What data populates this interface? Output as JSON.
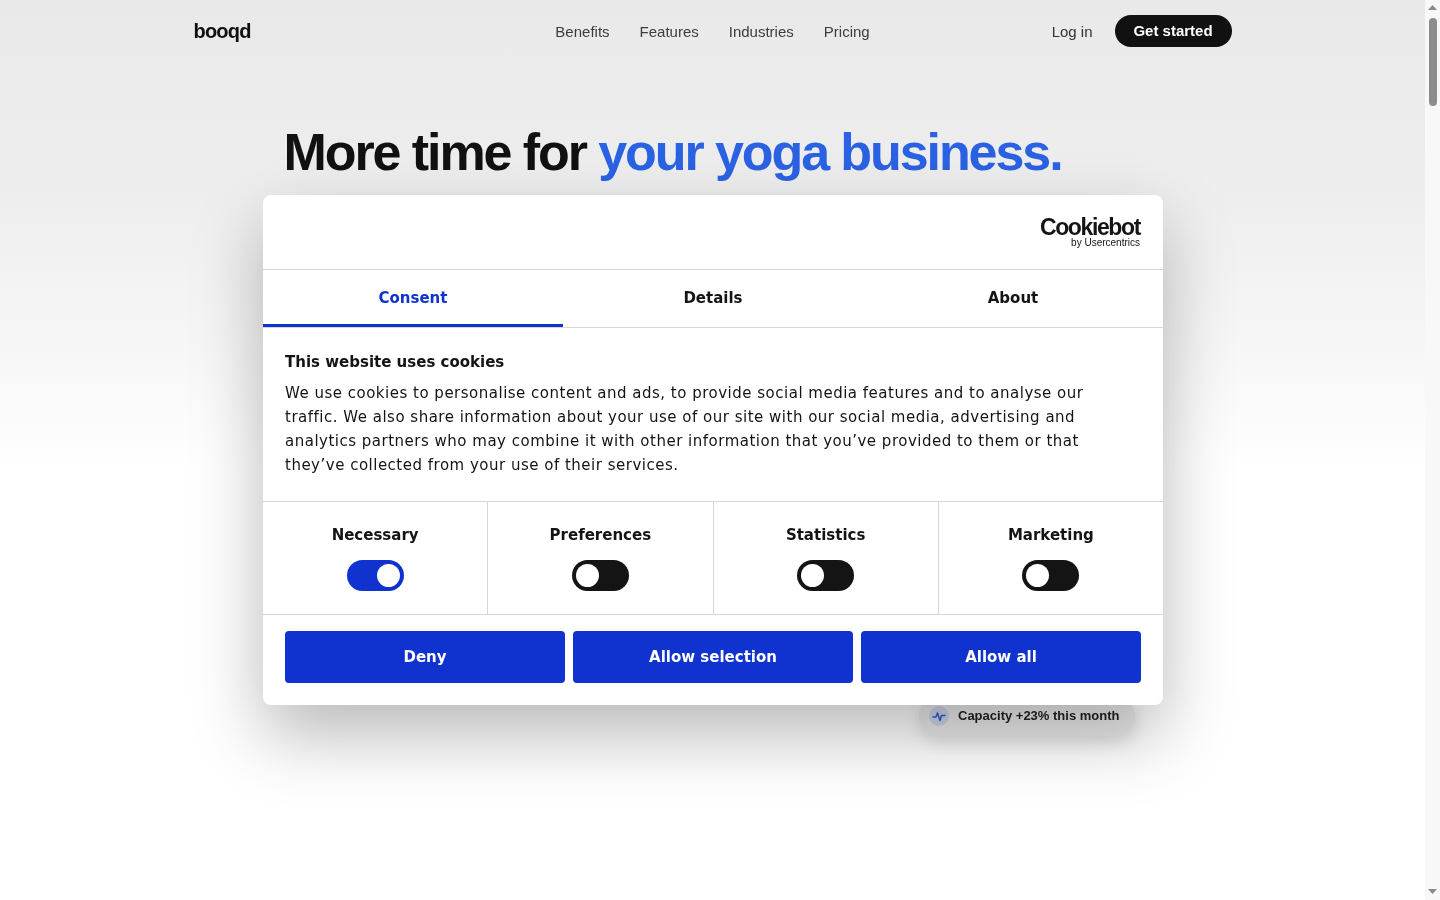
{
  "nav": {
    "logo": "booqd",
    "links": [
      {
        "label": "Benefits"
      },
      {
        "label": "Features"
      },
      {
        "label": "Industries"
      },
      {
        "label": "Pricing"
      }
    ],
    "login": "Log in",
    "cta": "Get started"
  },
  "hero": {
    "headline_lead": "More time for",
    "headline_highlight": "your yoga business.",
    "badge": "Capacity +23% this month"
  },
  "cookie_dialog": {
    "logo": {
      "wordmark": "Cookiebot",
      "byline": "by Usercentrics"
    },
    "tabs": [
      {
        "label": "Consent",
        "selected": true
      },
      {
        "label": "Details",
        "selected": false
      },
      {
        "label": "About",
        "selected": false
      }
    ],
    "title": "This website uses cookies",
    "body": "We use cookies to personalise content and ads, to provide social media features and to analyse our traffic. We also share information about your use of our site with our social media, advertising and analytics partners who may combine it with other information that you’ve provided to them or that they’ve collected from your use of their services.",
    "categories": [
      {
        "label": "Necessary",
        "on": true
      },
      {
        "label": "Preferences",
        "on": false
      },
      {
        "label": "Statistics",
        "on": false
      },
      {
        "label": "Marketing",
        "on": false
      }
    ],
    "buttons": [
      "Deny",
      "Allow selection",
      "Allow all"
    ]
  }
}
